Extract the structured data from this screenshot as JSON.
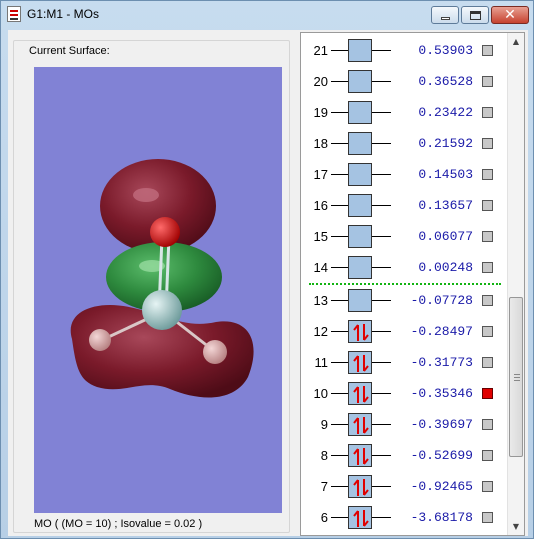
{
  "window": {
    "title": "G1:M1 - MOs"
  },
  "surface": {
    "group_label": "Current Surface:",
    "caption": "MO ( (MO = 10) ; Isovalue = 0.02 )"
  },
  "colors": {
    "viewer_background": "#8182d5",
    "occupied_arrow": "#e00000",
    "energy_text": "#1a1aa8",
    "homo_lumo_divider": "#12b312",
    "selected_mo": "#e00000",
    "orbital_positive": "#7a1a2a",
    "orbital_negative": "#2e7a3e"
  },
  "orbitals": [
    {
      "number": "21",
      "energy": "0.53903",
      "occupied": false,
      "selected": false
    },
    {
      "number": "20",
      "energy": "0.36528",
      "occupied": false,
      "selected": false
    },
    {
      "number": "19",
      "energy": "0.23422",
      "occupied": false,
      "selected": false
    },
    {
      "number": "18",
      "energy": "0.21592",
      "occupied": false,
      "selected": false
    },
    {
      "number": "17",
      "energy": "0.14503",
      "occupied": false,
      "selected": false
    },
    {
      "number": "16",
      "energy": "0.13657",
      "occupied": false,
      "selected": false
    },
    {
      "number": "15",
      "energy": "0.06077",
      "occupied": false,
      "selected": false
    },
    {
      "number": "14",
      "energy": "0.00248",
      "occupied": false,
      "selected": false
    },
    {
      "number": "13",
      "energy": "-0.07728",
      "occupied": false,
      "selected": false
    },
    {
      "number": "12",
      "energy": "-0.28497",
      "occupied": true,
      "selected": false
    },
    {
      "number": "11",
      "energy": "-0.31773",
      "occupied": true,
      "selected": false
    },
    {
      "number": "10",
      "energy": "-0.35346",
      "occupied": true,
      "selected": true
    },
    {
      "number": "9",
      "energy": "-0.39697",
      "occupied": true,
      "selected": false
    },
    {
      "number": "8",
      "energy": "-0.52699",
      "occupied": true,
      "selected": false
    },
    {
      "number": "7",
      "energy": "-0.92465",
      "occupied": true,
      "selected": false
    },
    {
      "number": "6",
      "energy": "-3.68178",
      "occupied": true,
      "selected": false
    }
  ],
  "icons": {
    "app": "gaussview-document-icon",
    "minimize": "minimize-icon",
    "maximize": "maximize-icon",
    "close": "close-icon",
    "scroll_up": "chevron-up-icon",
    "scroll_down": "chevron-down-icon"
  }
}
